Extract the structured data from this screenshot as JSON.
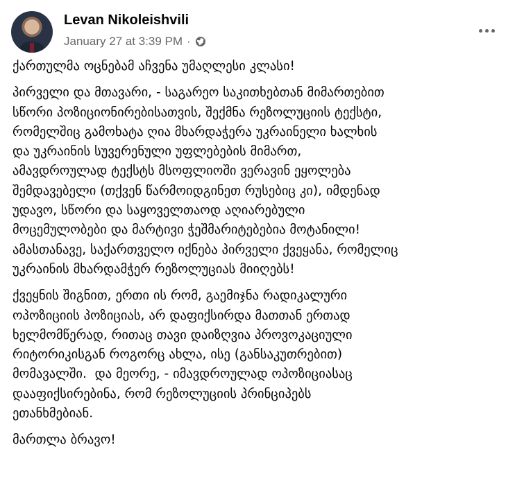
{
  "post": {
    "author": "Levan Nikoleishvili",
    "timestamp": "January 27 at 3:39 PM",
    "separator": "·",
    "audience_icon": "globe-icon",
    "more_icon": "more-options-icon",
    "paragraphs": [
      [
        "ქართულმა ოცნებამ აჩვენა უმაღლესი კლასი!"
      ],
      [
        "პირველი და მთავარი, - საგარეო საკითხებთან მიმართებით",
        "სწორი პოზიციონირებისათვის, შექმნა რეზოლუციის ტექსტი,",
        "რომელშიც გამოხატა ღია მხარდაჭერა უკრაინელი ხალხის",
        "და უკრაინის სუვერენული უფლებების მიმართ,",
        "ამავდროულად ტექსტს მსოფლიოში ვერავინ ეყოლება",
        "შემდავებელი (თქვენ წარმოიდგინეთ რუსებიც კი), იმდენად",
        "უდავო, სწორი და საყოველთაოდ აღიარებული",
        "მოცემულობები და მარტივი ჭეშმარიტებებია მოტანილი!",
        "ამასთანავე, საქართველო იქნება პირველი ქვეყანა, რომელიც",
        "უკრაინის მხარდამჭერ რეზოლუციას მიიღებს!"
      ],
      [
        "ქვეყნის შიგნით, ერთი ის რომ, გაემიჯნა რადიკალური",
        "ოპოზიციის პოზიციას, არ დაფიქსირდა მათთან ერთად",
        "ხელმომწერად, რითაც თავი დაიზღვია პროვოკაციული",
        "რიტორიკისგან როგორც ახლა, ისე (განსაკუთრებით)",
        "მომავალში.  და მეორე, - იმავდროულად ოპოზიციასაც",
        "დააფიქსირებინა, რომ რეზოლუციის პრინციპებს",
        "ეთანხმებიან."
      ],
      [
        "მართლა ბრავო!"
      ]
    ]
  }
}
